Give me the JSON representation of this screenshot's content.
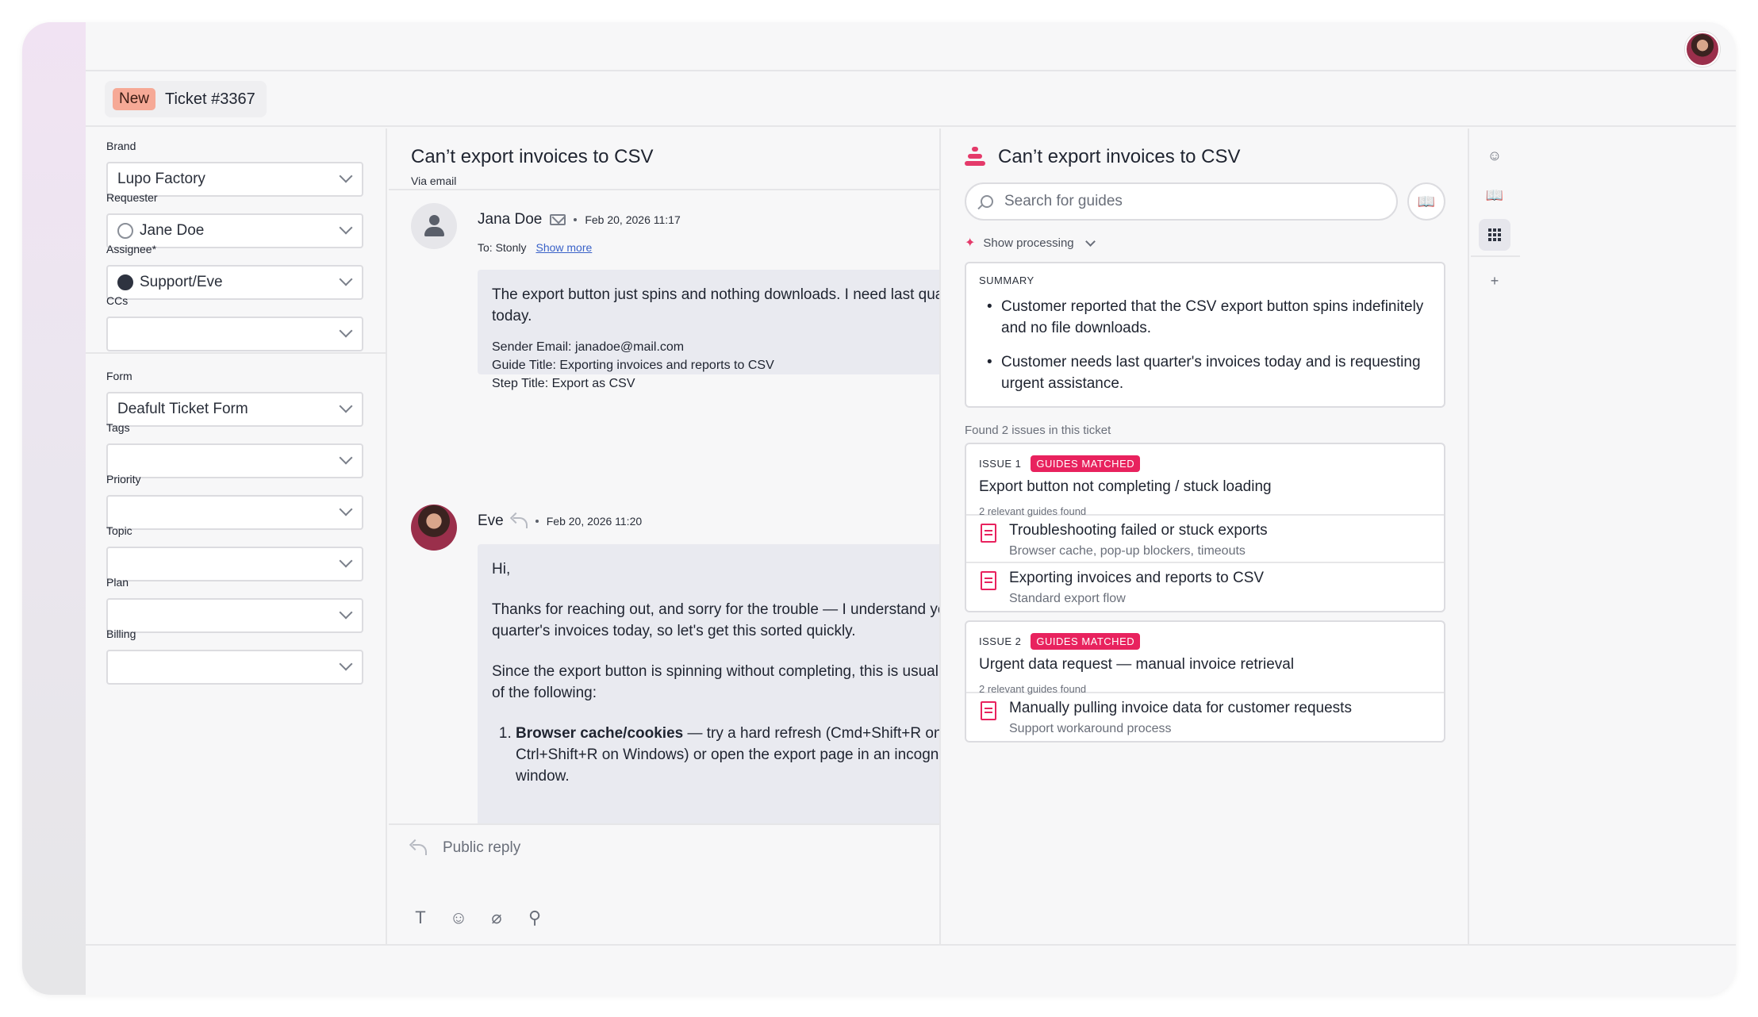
{
  "header": {
    "avatar_label": ""
  },
  "ticket_tab": {
    "badge": "New",
    "title": "Ticket #3367"
  },
  "fields": {
    "brand": {
      "label": "Brand",
      "value": "Lupo Factory"
    },
    "requester": {
      "label": "Requester",
      "value": "Jane Doe"
    },
    "assignee": {
      "label": "Assignee*",
      "value": "Support/Eve"
    },
    "ccs": {
      "label": "CCs",
      "value": ""
    },
    "form": {
      "label": "Form",
      "value": "Deafult Ticket Form"
    },
    "tags": {
      "label": "Tags",
      "value": ""
    },
    "priority": {
      "label": "Priority",
      "value": ""
    },
    "topic": {
      "label": "Topic",
      "value": ""
    },
    "plan": {
      "label": "Plan",
      "value": ""
    },
    "billing": {
      "label": "Billing",
      "value": ""
    }
  },
  "conversation": {
    "title": "Can’t export invoices to CSV",
    "channel": "Via email",
    "messages": [
      {
        "author": "Jana Doe",
        "date": "Feb 20, 2026 11:17",
        "to_label": "To: Stonly",
        "show_more": "Show more",
        "body": "The export button just spins and nothing downloads. I need last quarter's invoices today.",
        "details": [
          "Sender Email: janadoe@mail.com",
          "Guide Title: Exporting invoices and reports to CSV",
          "Step Title: Export as CSV"
        ]
      },
      {
        "author": "Eve",
        "date": "Feb 20, 2026 11:20",
        "greeting": "Hi,",
        "para1": "Thanks for reaching out, and sorry for the trouble — I understand you need last quarter's invoices today, so let's get this sorted quickly.",
        "para2": "Since the export button is spinning without completing, this is usually caused by one of the following:",
        "list_item_1_bold": "Browser cache/cookies",
        "list_item_1_rest": " — try a hard refresh (Cmd+Shift+R on Mac, Ctrl+Shift+R on Windows) or open the export page in an incognito/private window."
      }
    ],
    "compose_label": "Public reply",
    "tools": [
      "T",
      "☺",
      "⌀",
      "⚲"
    ]
  },
  "assistant": {
    "title": "Can’t export invoices to CSV",
    "search_placeholder": "Search for guides",
    "show_processing": "Show processing",
    "summary_label": "SUMMARY",
    "summary_points": [
      "Customer reported that the CSV export button spins indefinitely and no file downloads.",
      "Customer needs last quarter's invoices today and is requesting urgent assistance."
    ],
    "found_text": "Found 2 issues in this ticket",
    "issues": [
      {
        "label": "ISSUE 1",
        "tag": "GUIDES MATCHED",
        "title": "Export button not completing / stuck loading",
        "count": "2 relevant guides found",
        "guides": [
          {
            "title": "Troubleshooting failed or stuck exports",
            "sub": "Browser cache, pop-up blockers, timeouts"
          },
          {
            "title": "Exporting invoices and reports to CSV",
            "sub": "Standard export flow"
          }
        ]
      },
      {
        "label": "ISSUE 2",
        "tag": "GUIDES MATCHED",
        "title": "Urgent data request — manual invoice retrieval",
        "count": "2 relevant guides found",
        "guides": [
          {
            "title": "Manually pulling invoice data for customer requests",
            "sub": "Support workaround process"
          }
        ]
      }
    ]
  },
  "colors": {
    "accent": "#e8225e",
    "badge_new": "#f6a996",
    "link": "#3a62c8"
  }
}
